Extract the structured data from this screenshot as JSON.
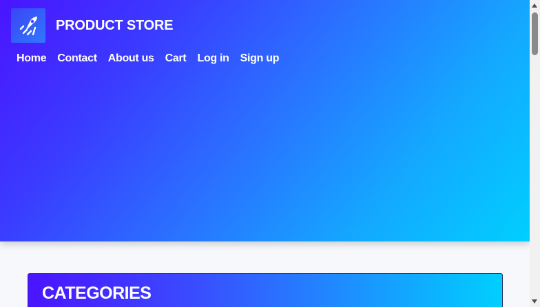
{
  "brand": {
    "name": "PRODUCT STORE",
    "logo_icon": "rocket-icon"
  },
  "nav": {
    "items": [
      {
        "label": "Home"
      },
      {
        "label": "Contact"
      },
      {
        "label": "About us"
      },
      {
        "label": "Cart"
      },
      {
        "label": "Log in"
      },
      {
        "label": "Sign up"
      }
    ]
  },
  "categories": {
    "title": "CATEGORIES"
  },
  "colors": {
    "gradient_start": "#4a14ff",
    "gradient_end": "#00cfff",
    "text": "#ffffff"
  }
}
